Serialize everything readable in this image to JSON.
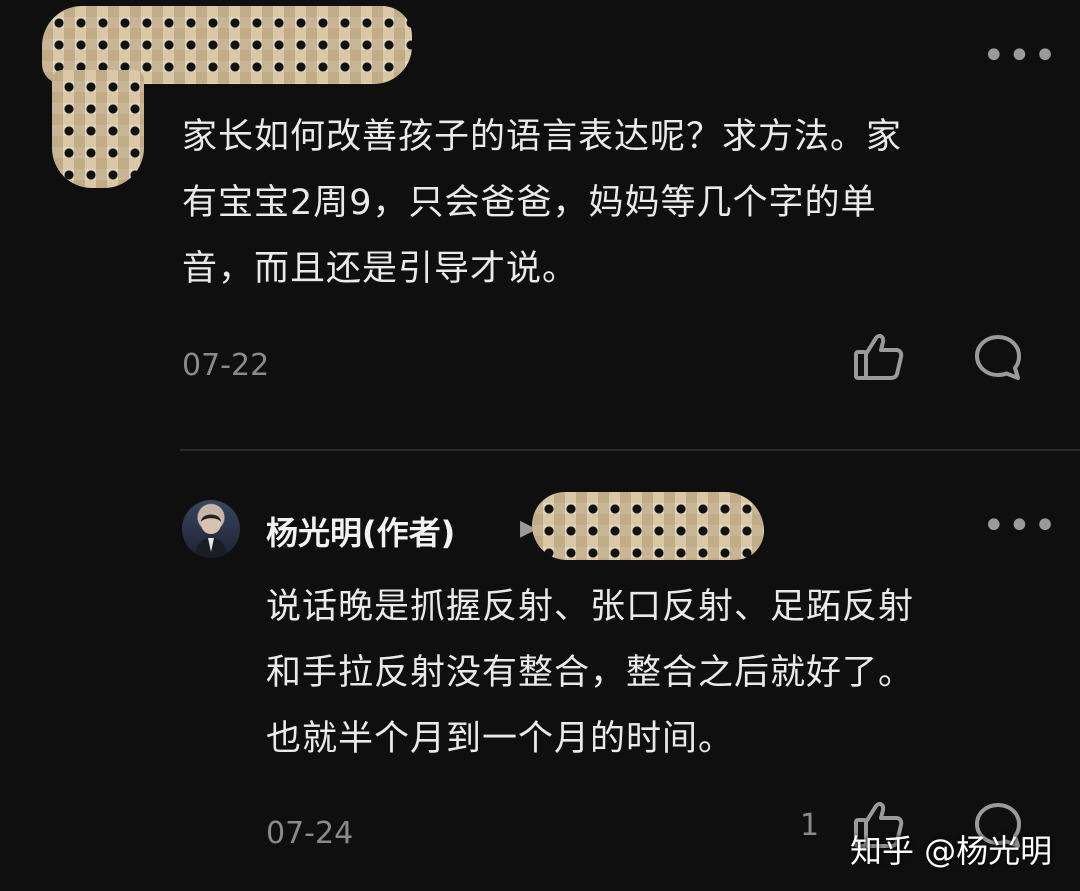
{
  "first_comment": {
    "text_line1": "家长如何改善孩子的语言表达呢？求方法。家",
    "text_line2": "有宝宝2周9，只会爸爸，妈妈等几个字的单",
    "text_line3": "音，而且还是引导才说。",
    "date": "07-22",
    "more_glyph": "•••",
    "icons": [
      "thumbs-up-icon",
      "comment-icon"
    ]
  },
  "reply": {
    "author": "杨光明(作者)",
    "reply_arrow_glyph": "▶",
    "text_line1": "说话晚是抓握反射、张口反射、足跖反射",
    "text_line2": "和手拉反射没有整合，整合之后就好了。",
    "text_line3": "也就半个月到一个月的时间。",
    "date": "07-24",
    "like_count": "1",
    "more_glyph": "•••",
    "icons": [
      "thumbs-up-icon",
      "comment-icon"
    ]
  },
  "watermark": "知乎 @杨光明",
  "colors": {
    "background": "#0f0f0f",
    "text": "#eaeaea",
    "muted": "#8a8a8a",
    "mosaic": "#d9c7a6"
  }
}
